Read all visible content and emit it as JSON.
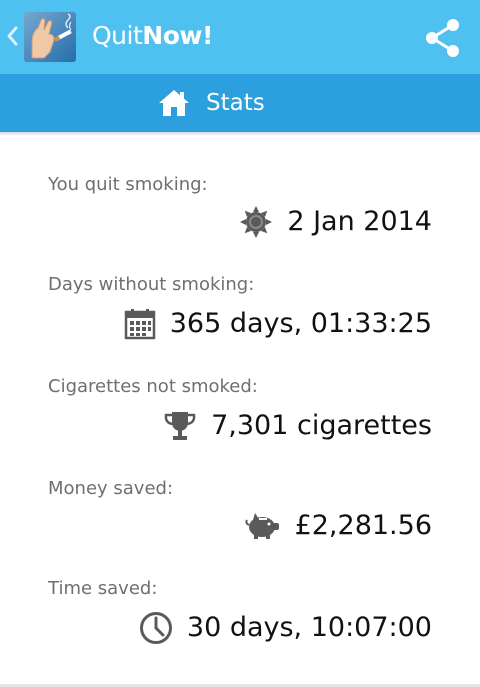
{
  "app": {
    "title_light": "Quit",
    "title_bold": "Now!",
    "brand_color": "#4ec1f1",
    "tab_color": "#2c9fde"
  },
  "actionbar": {
    "back_icon": "chevron-left-icon",
    "share_icon": "share-icon"
  },
  "tab": {
    "icon": "home-icon",
    "label": "Stats"
  },
  "stats": [
    {
      "label": "You quit smoking:",
      "value": "2 Jan 2014",
      "icon": "sun-icon"
    },
    {
      "label": "Days without smoking:",
      "value": "365 days, 01:33:25",
      "icon": "calendar-icon"
    },
    {
      "label": "Cigarettes not smoked:",
      "value": "7,301 cigarettes",
      "icon": "trophy-icon"
    },
    {
      "label": "Money saved:",
      "value": "£2,281.56",
      "icon": "piggy-bank-icon"
    },
    {
      "label": "Time saved:",
      "value": "30 days, 10:07:00",
      "icon": "clock-icon"
    }
  ]
}
